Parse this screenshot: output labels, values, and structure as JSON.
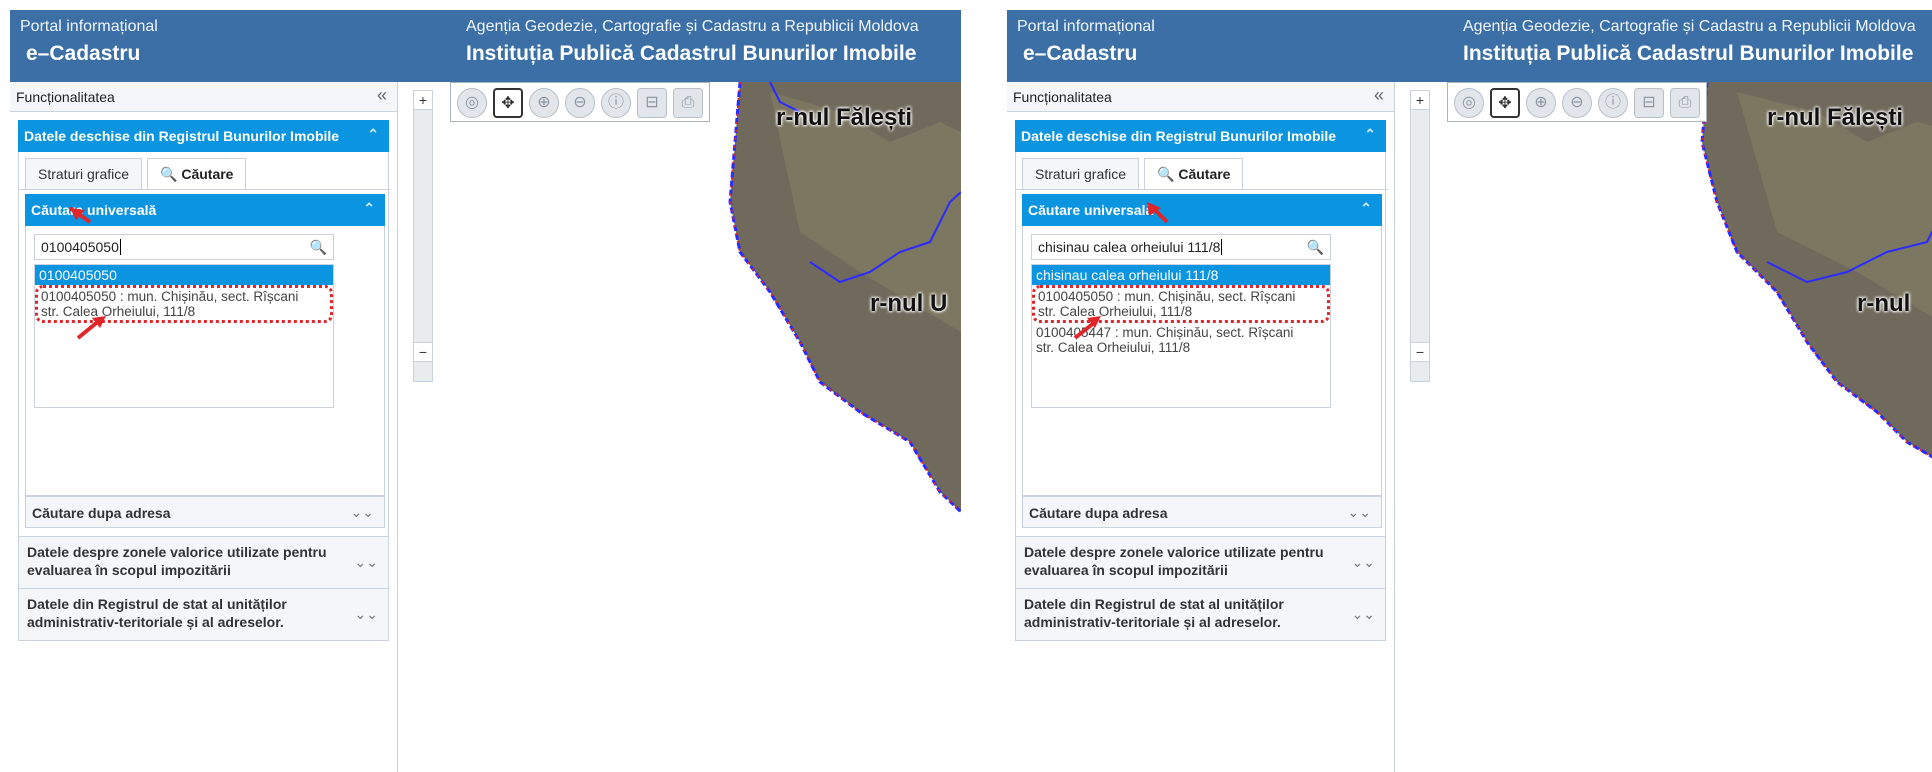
{
  "header": {
    "portal": "Portal informațional",
    "ecadastru": "e–Cadastru",
    "agency": "Agenția Geodezie, Cartografie și Cadastru a Republicii Moldova",
    "institution": "Instituția Publică Cadastrul Bunurilor Imobile"
  },
  "panel": {
    "title": "Funcționalitatea",
    "collapse_icon": "«"
  },
  "accordion": {
    "open_section": "Datele deschise din Registrul Bunurilor Imobile",
    "tabs": {
      "layers": "Straturi grafice",
      "search": "Căutare"
    },
    "universal_search": "Căutare universală",
    "address_search": "Căutare dupa adresa",
    "zones": "Datele despre zonele valorice utilizate pentru evaluarea în scopul impozitării",
    "registry": "Datele din Registrul de stat al unităților administrativ-teritoriale și al adreselor."
  },
  "screens": {
    "left": {
      "query": "0100405050",
      "selected": "0100405050",
      "results": [
        {
          "line1": "0100405050 : mun. Chișinău, sect. Rîșcani",
          "line2": "str. Calea Orheiului, 111/8"
        }
      ],
      "map_labels": [
        "r-nul Fălești",
        "r-nul U"
      ]
    },
    "right": {
      "query": "chisinau calea orheiului 111/8",
      "selected": "chisinau calea orheiului 111/8",
      "results": [
        {
          "line1": "0100405050 : mun. Chișinău, sect. Rîșcani",
          "line2": "str. Calea Orheiului, 111/8"
        },
        {
          "line1": "0100405447 : mun. Chișinău, sect. Rîșcani",
          "line2": "str. Calea Orheiului, 111/8"
        }
      ],
      "map_labels": [
        "r-nul Fălești",
        "r-nul"
      ]
    }
  },
  "zoom": {
    "plus": "+",
    "minus": "−"
  },
  "icons": {
    "globe": "globe-icon",
    "pan": "pan-icon",
    "zoom_in": "zoom-in-icon",
    "zoom_out": "zoom-out-icon",
    "info": "info-icon",
    "measure": "measure-icon",
    "print": "print-icon",
    "search": "search-icon"
  },
  "colors": {
    "header": "#3b6fa6",
    "accent": "#0b94e0",
    "highlight": "#e0262a",
    "border_line": "#2b2bff"
  }
}
